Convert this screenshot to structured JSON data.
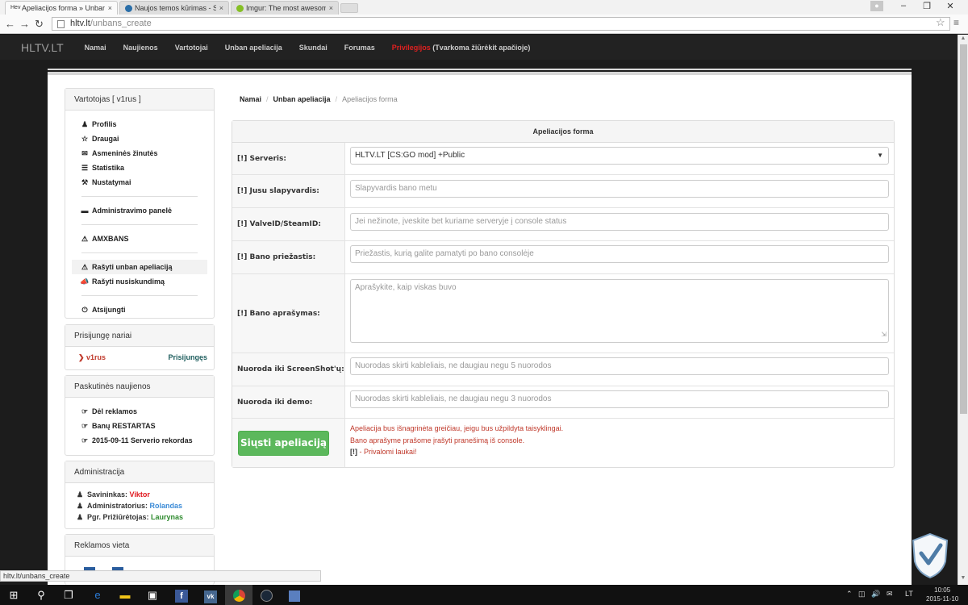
{
  "browser": {
    "tabs": [
      {
        "icon": "Hev",
        "title": "Apeliacijos forma » Unbans",
        "active": true
      },
      {
        "icon": "steam-icon",
        "title": "Naujos temos kūrimas - S",
        "active": false
      },
      {
        "icon": "imgur-icon",
        "title": "Imgur: The most awesome",
        "active": false
      }
    ],
    "close_glyph": "×",
    "url_host": "hltv.lt",
    "url_path": "/unbans_create"
  },
  "site": {
    "brand": "HLTV.LT",
    "nav": [
      {
        "label": "Namai"
      },
      {
        "label": "Naujienos"
      },
      {
        "label": "Vartotojai"
      },
      {
        "label": "Unban apeliacija"
      },
      {
        "label": "Skundai"
      },
      {
        "label": "Forumas"
      }
    ],
    "nav_priv": "Privilegijos",
    "nav_priv_note": " (Tvarkoma žiūrėkit apačioje)"
  },
  "sidebar": {
    "user_box": {
      "title": "Vartotojas [ v1rus ]",
      "items": [
        {
          "icon": "user-icon",
          "label": "Profilis"
        },
        {
          "icon": "star-icon",
          "label": "Draugai"
        },
        {
          "icon": "envelope-icon",
          "label": "Asmeninės žinutės"
        },
        {
          "icon": "list-icon",
          "label": "Statistika"
        },
        {
          "icon": "wrench-icon",
          "label": "Nustatymai"
        }
      ],
      "admin_panel": "Administravimo panelė",
      "amxbans": "AMXBANS",
      "write_unban": "Rašyti unban apeliaciją",
      "write_complaint": "Rašyti nusiskundimą",
      "logout": "Atsijungti"
    },
    "online_box": {
      "title": "Prisijungę nariai",
      "user": "v1rus",
      "status": "Prisijungęs"
    },
    "news_box": {
      "title": "Paskutinės naujienos",
      "items": [
        {
          "label": "Dėl reklamos"
        },
        {
          "label": "Banų RESTARTAS"
        },
        {
          "label": "2015-09-11 Serverio rekordas"
        }
      ]
    },
    "admin_box": {
      "title": "Administracija",
      "rows": [
        {
          "role": "Savininkas: ",
          "name": "Viktor"
        },
        {
          "role": "Administratorius: ",
          "name": "Rolandas"
        },
        {
          "role": "Pgr. Prižiūrėtojas: ",
          "name": "Laurynas"
        }
      ]
    },
    "ads_box": {
      "title": "Reklamos vieta"
    }
  },
  "breadcrumb": {
    "home": "Namai",
    "section": "Unban apeliacija",
    "current": "Apeliacijos forma",
    "sep": "/"
  },
  "form": {
    "title": "Apeliacijos forma",
    "server_label": "[!] Serveris:",
    "server_value": "HLTV.LT [CS:GO mod] +Public",
    "nick_label": "[!] Jusu slapyvardis:",
    "nick_placeholder": "Slapyvardis bano metu",
    "steam_label": "[!] ValveID/SteamID:",
    "steam_placeholder": "Jei nežinote, įveskite bet kuriame serveryje į console status",
    "reason_label": "[!] Bano priežastis:",
    "reason_placeholder": "Priežastis, kurią galite pamatyti po bano consolėje",
    "desc_label": "[!] Bano aprašymas:",
    "desc_placeholder": "Aprašykite, kaip viskas buvo",
    "screenshot_label": "Nuoroda iki ScreenShot'ų:",
    "screenshot_placeholder": "Nuorodas skirti kableliais, ne daugiau negu 5 nuorodos",
    "demo_label": "Nuoroda iki demo:",
    "demo_placeholder": "Nuorodas skirti kableliais, ne daugiau negu 3 nuorodos",
    "submit": "Siųsti apeliaciją",
    "note1": "Apeliacija bus išnagrinėta greičiau, jeigu bus užpildyta taisyklingai.",
    "note2": "Bano aprašyme prašome įrašyti pranešimą iš console.",
    "note3_mark": "[!]",
    "note3_text": " - Privalomi laukai!"
  },
  "status_url": "hltv.lt/unbans_create",
  "taskbar": {
    "lang": "LT",
    "time": "10:05",
    "date": "2015-11-10"
  }
}
